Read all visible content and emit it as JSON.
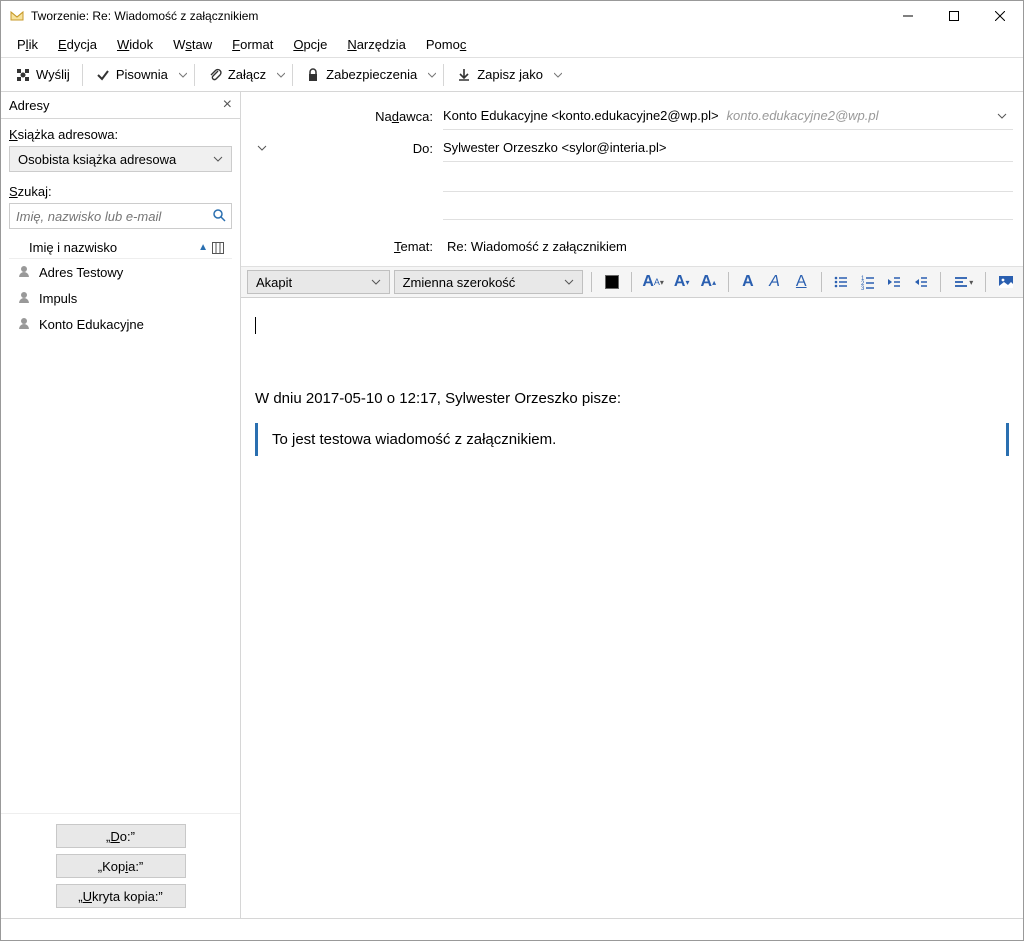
{
  "window": {
    "title": "Tworzenie: Re: Wiadomość z załącznikiem"
  },
  "menus": {
    "file": {
      "pre": "P",
      "u": "l",
      "post": "ik"
    },
    "edit": {
      "pre": "",
      "u": "E",
      "post": "dycja"
    },
    "view": {
      "pre": "",
      "u": "W",
      "post": "idok"
    },
    "insert": {
      "pre": "W",
      "u": "s",
      "post": "taw"
    },
    "format": {
      "pre": "",
      "u": "F",
      "post": "ormat"
    },
    "options": {
      "pre": "",
      "u": "O",
      "post": "pcje"
    },
    "tools": {
      "pre": "",
      "u": "N",
      "post": "arzędzia"
    },
    "help": {
      "pre": "Pomo",
      "u": "c",
      "post": ""
    }
  },
  "toolbar": {
    "send": "Wyślij",
    "spell": "Pisownia",
    "attach": "Załącz",
    "security": "Zabezpieczenia",
    "save": "Zapisz jako"
  },
  "sidebar": {
    "title": "Adresy",
    "book_label": {
      "pre": "",
      "u": "K",
      "post": "siążka adresowa:"
    },
    "book_selected": "Osobista książka adresowa",
    "search_label": {
      "pre": "",
      "u": "S",
      "post": "zukaj:"
    },
    "search_placeholder": "Imię, nazwisko lub e-mail",
    "list_col": "Imię i nazwisko",
    "contacts": [
      "Adres Testowy",
      "Impuls",
      "Konto Edukacyjne"
    ],
    "btn_to": "„Do:”",
    "btn_cc": "„Kopia:”",
    "btn_bcc": "„Ukryta kopia:”"
  },
  "headers": {
    "from_label": {
      "pre": "Na",
      "u": "d",
      "post": "awca:"
    },
    "from_value": "Konto Edukacyjne <konto.edukacyjne2@wp.pl>",
    "from_extra": "konto.edukacyjne2@wp.pl",
    "to_label": "Do:",
    "to_value": "Sylwester Orzeszko <sylor@interia.pl>",
    "subject_label": {
      "pre": "",
      "u": "T",
      "post": "emat:"
    },
    "subject_value": "Re: Wiadomość z załącznikiem"
  },
  "format_bar": {
    "para": "Akapit",
    "font": "Zmienna szerokość"
  },
  "body": {
    "quote_header": "W dniu 2017-05-10 o 12:17, Sylwester Orzeszko pisze:",
    "quote_text": "To jest testowa wiadomość z załącznikiem."
  }
}
